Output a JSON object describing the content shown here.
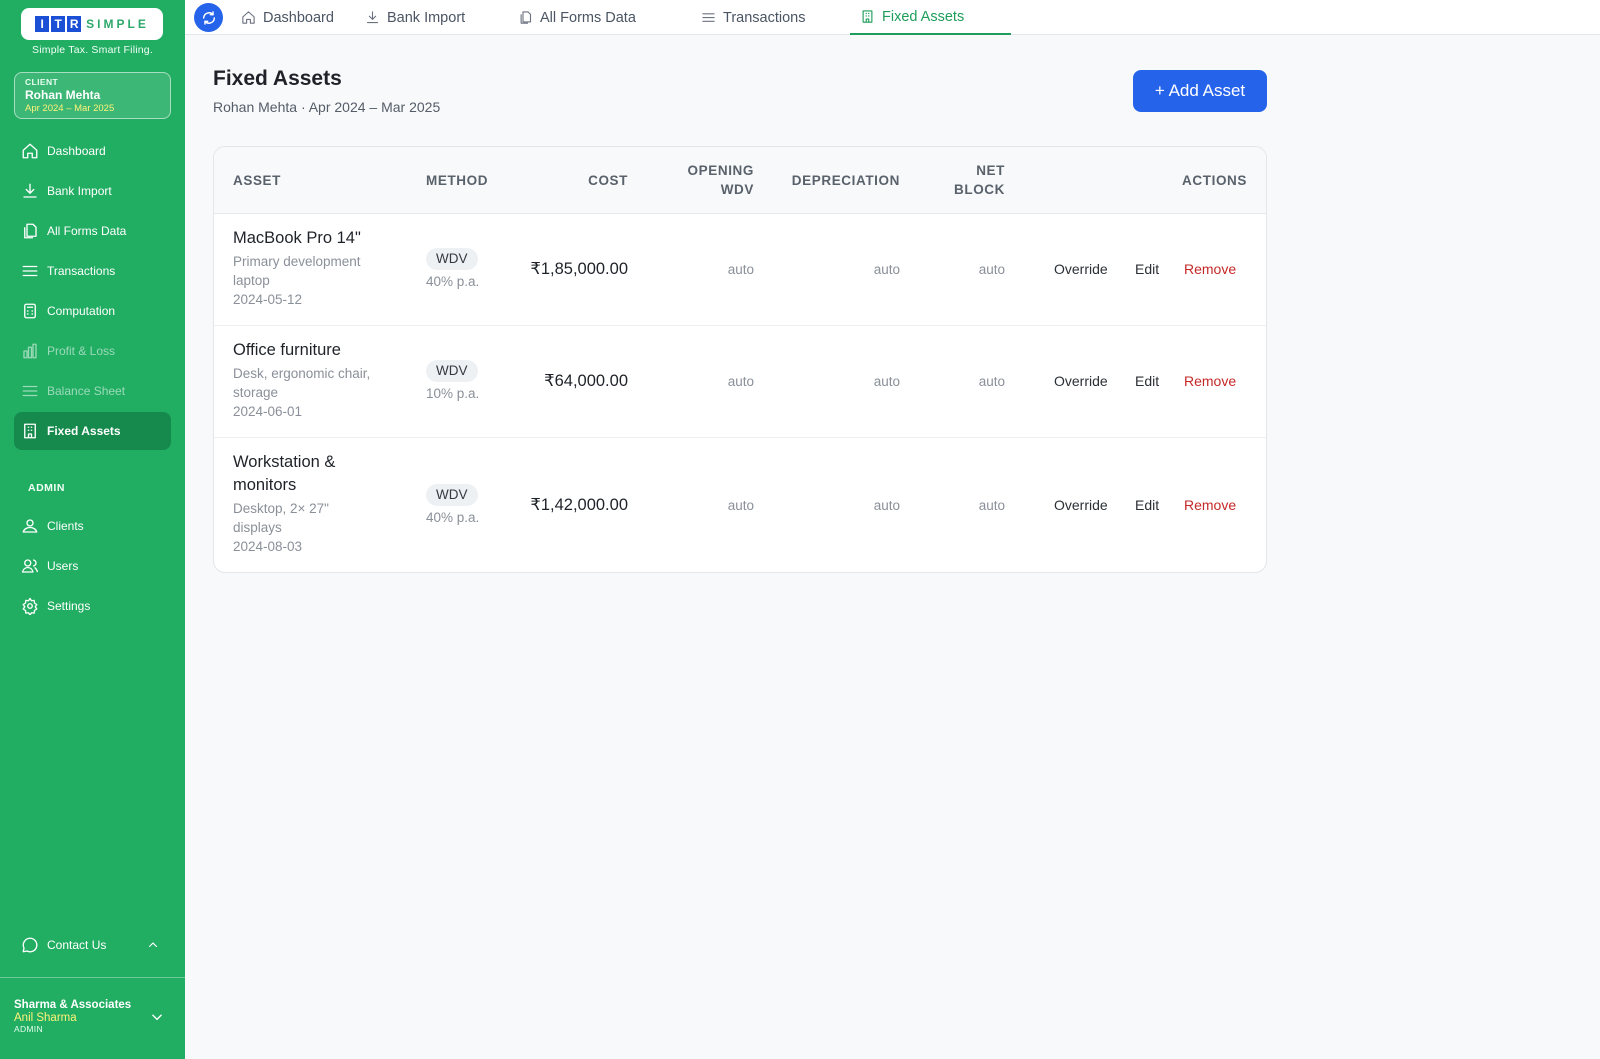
{
  "brand": {
    "logo_letters": [
      "I",
      "T",
      "R"
    ],
    "logo_rest": "SIMPLE",
    "tagline": "Simple Tax. Smart Filing."
  },
  "client": {
    "label": "CLIENT",
    "name": "Rohan Mehta",
    "period": "Apr 2024 – Mar 2025"
  },
  "sidebar": {
    "items": [
      {
        "label": "Dashboard",
        "icon": "home-icon"
      },
      {
        "label": "Bank Import",
        "icon": "download-icon"
      },
      {
        "label": "All Forms Data",
        "icon": "documents-icon"
      },
      {
        "label": "Transactions",
        "icon": "list-icon"
      },
      {
        "label": "Computation",
        "icon": "calculator-icon"
      },
      {
        "label": "Profit & Loss",
        "icon": "bar-chart-icon",
        "state": "disabled"
      },
      {
        "label": "Balance Sheet",
        "icon": "list-icon",
        "state": "disabled"
      },
      {
        "label": "Fixed Assets",
        "icon": "building-icon",
        "state": "active"
      }
    ],
    "admin_label": "ADMIN",
    "admin_items": [
      {
        "label": "Clients",
        "icon": "client-icon"
      },
      {
        "label": "Users",
        "icon": "users-icon"
      },
      {
        "label": "Settings",
        "icon": "gear-icon"
      }
    ],
    "contact_label": "Contact Us",
    "user": {
      "firm": "Sharma & Associates",
      "name": "Anil Sharma",
      "role": "ADMIN"
    }
  },
  "topbar": {
    "tabs": [
      {
        "label": "Dashboard",
        "icon": "home-icon"
      },
      {
        "label": "Bank Import",
        "icon": "download-icon"
      },
      {
        "label": "All Forms Data",
        "icon": "documents-icon"
      },
      {
        "label": "Transactions",
        "icon": "list-icon"
      },
      {
        "label": "Fixed Assets",
        "icon": "building-icon",
        "state": "active"
      }
    ]
  },
  "page": {
    "title": "Fixed Assets",
    "subtitle": "Rohan Mehta · Apr 2024 – Mar 2025",
    "add_button": "+ Add Asset"
  },
  "table": {
    "headers": {
      "asset": "ASSET",
      "method": "METHOD",
      "cost": "COST",
      "opening_1": "OPENING",
      "opening_2": "WDV",
      "depreciation": "DEPRECIATION",
      "net_1": "NET",
      "net_2": "BLOCK",
      "actions": "ACTIONS"
    },
    "rows": [
      {
        "name": "MacBook Pro 14\"",
        "desc_1": "Primary development",
        "desc_2": "laptop",
        "date": "2024-05-12",
        "method": "WDV",
        "rate": "40% p.a.",
        "cost": "₹1,85,000.00",
        "opening_wdv": "auto",
        "depreciation": "auto",
        "net_block": "auto"
      },
      {
        "name": "Office furniture",
        "desc_1": "Desk, ergonomic chair,",
        "desc_2": "storage",
        "date": "2024-06-01",
        "method": "WDV",
        "rate": "10% p.a.",
        "cost": "₹64,000.00",
        "opening_wdv": "auto",
        "depreciation": "auto",
        "net_block": "auto"
      },
      {
        "name_1": "Workstation &",
        "name_2": "monitors",
        "desc_1": "Desktop, 2× 27\"",
        "desc_2": "displays",
        "date": "2024-08-03",
        "method": "WDV",
        "rate": "40% p.a.",
        "cost": "₹1,42,000.00",
        "opening_wdv": "auto",
        "depreciation": "auto",
        "net_block": "auto"
      }
    ],
    "actions": {
      "override": "Override",
      "edit": "Edit",
      "remove": "Remove"
    }
  },
  "colors": {
    "sidebar": "#21ad62",
    "sidebar_active": "#158a4c",
    "primary": "#2563eb",
    "active_tab": "#1f9d5a",
    "remove": "#c62828",
    "highlight": "#fff27a"
  }
}
